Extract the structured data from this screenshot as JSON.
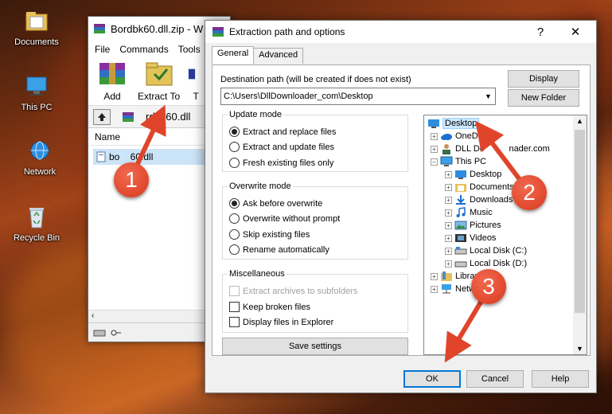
{
  "desktop": {
    "icons": [
      {
        "label": "Documents",
        "icon": "documents-folder-icon"
      },
      {
        "label": "This PC",
        "icon": "this-pc-icon"
      },
      {
        "label": "Network",
        "icon": "network-icon"
      },
      {
        "label": "Recycle Bin",
        "icon": "recycle-bin-icon"
      }
    ]
  },
  "winrar": {
    "title": "Bordbk60.dll.zip - W",
    "menu": [
      "File",
      "Commands",
      "Tools"
    ],
    "toolbar": {
      "add_label": "Add",
      "extract_label": "Extract To",
      "third_label": "T"
    },
    "path": "rdbk60.dll",
    "column_name": "Name",
    "file_name": "bo    60.dll"
  },
  "dialog": {
    "title": "Extraction path and options",
    "help_btn": "?",
    "close_btn": "✕",
    "tabs": [
      "General",
      "Advanced"
    ],
    "dest_label": "Destination path (will be created if does not exist)",
    "dest_value": "C:\\Users\\DllDownloader_com\\Desktop",
    "display_btn": "Display",
    "new_folder_btn": "New Folder",
    "update_mode": {
      "title": "Update mode",
      "options": [
        "Extract and replace files",
        "Extract and update files",
        "Fresh existing files only"
      ],
      "selected": 0
    },
    "overwrite_mode": {
      "title": "Overwrite mode",
      "options": [
        "Ask before overwrite",
        "Overwrite without prompt",
        "Skip existing files",
        "Rename automatically"
      ],
      "selected": 0
    },
    "misc": {
      "title": "Miscellaneous",
      "options": [
        "Extract archives to subfolders",
        "Keep broken files",
        "Display files in Explorer"
      ]
    },
    "save_settings_btn": "Save settings",
    "tree": [
      {
        "label": "Desktop",
        "level": 0,
        "icon": "desktop-icon",
        "selected": true
      },
      {
        "label": "OneD",
        "level": 1,
        "icon": "onedrive-icon"
      },
      {
        "label": "DLL Do          nader.com",
        "level": 1,
        "icon": "user-icon"
      },
      {
        "label": "This PC",
        "level": 1,
        "icon": "this-pc-icon"
      },
      {
        "label": "Desktop",
        "level": 2,
        "icon": "desktop-icon"
      },
      {
        "label": "Documents",
        "level": 2,
        "icon": "documents-icon"
      },
      {
        "label": "Downloads",
        "level": 2,
        "icon": "downloads-icon"
      },
      {
        "label": "Music",
        "level": 2,
        "icon": "music-icon"
      },
      {
        "label": "Pictures",
        "level": 2,
        "icon": "pictures-icon"
      },
      {
        "label": "Videos",
        "level": 2,
        "icon": "videos-icon"
      },
      {
        "label": "Local Disk (C:)",
        "level": 2,
        "icon": "local-disk-icon"
      },
      {
        "label": "Local Disk (D:)",
        "level": 2,
        "icon": "local-disk-icon"
      },
      {
        "label": "Librari",
        "level": 1,
        "icon": "libraries-icon"
      },
      {
        "label": "Netw",
        "level": 1,
        "icon": "network-icon"
      }
    ],
    "ok_btn": "OK",
    "cancel_btn": "Cancel",
    "help_btn_label": "Help"
  },
  "annotations": [
    {
      "step": "1"
    },
    {
      "step": "2"
    },
    {
      "step": "3"
    }
  ],
  "colors": {
    "arrow": "#e0452b",
    "selection": "#cce8ff",
    "accent": "#0078d7"
  }
}
